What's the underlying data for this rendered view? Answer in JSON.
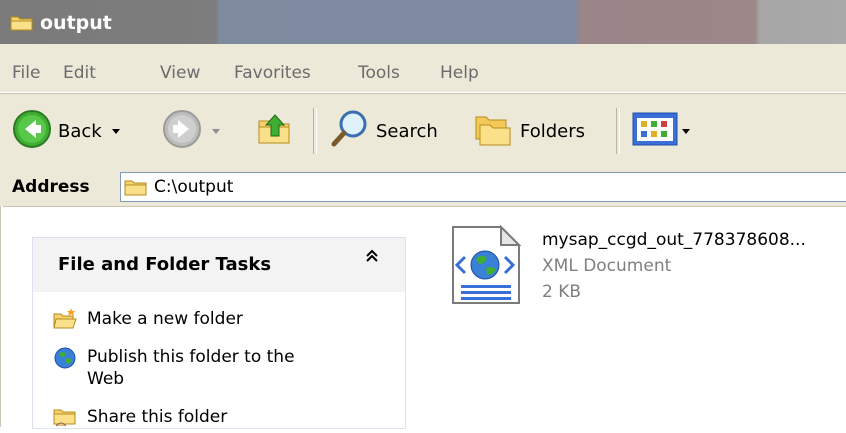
{
  "window": {
    "title": "output"
  },
  "menu": [
    "File",
    "Edit",
    "View",
    "Favorites",
    "Tools",
    "Help"
  ],
  "toolbar": {
    "back_label": "Back",
    "search_label": "Search",
    "folders_label": "Folders",
    "icons": [
      "back-arrow-icon",
      "forward-arrow-icon",
      "up-folder-icon",
      "search-icon",
      "folders-icon",
      "views-icon"
    ]
  },
  "address": {
    "label": "Address",
    "value": "C:\\output"
  },
  "tasks_panel": {
    "title": "File and Folder Tasks",
    "items": [
      {
        "label": "Make a new folder",
        "icon": "new-folder-icon"
      },
      {
        "label": "Publish this folder to the Web",
        "icon": "publish-web-icon"
      },
      {
        "label": "Share this folder",
        "icon": "share-folder-icon"
      }
    ]
  },
  "file": {
    "name": "mysap_ccgd_out_778378608...",
    "type": "XML Document",
    "size": "2 KB",
    "icon": "xml-document-icon"
  },
  "colors": {
    "chrome": "#ece9d8",
    "title_bar": "#7d7d7d",
    "task_header": "#f3f3f3",
    "address_border": "#7f9db9"
  }
}
